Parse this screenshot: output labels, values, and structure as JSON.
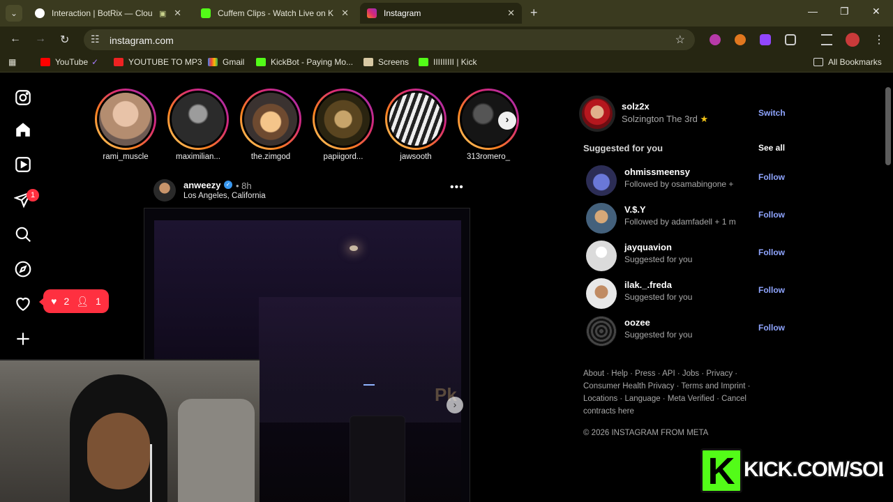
{
  "browser": {
    "tabs": [
      {
        "title": "Interaction | BotRix — Clou",
        "active": false
      },
      {
        "title": "Cuffem Clips - Watch Live on Ki",
        "active": false
      },
      {
        "title": "Instagram",
        "active": true
      }
    ],
    "url": "instagram.com",
    "bookmarks": [
      "YouTube",
      "YOUTUBE TO MP3",
      "Gmail",
      "KickBot - Paying Mo...",
      "Screens",
      "IIIIIIIII | Kick"
    ],
    "all_bookmarks": "All Bookmarks"
  },
  "sidebar": {
    "messages_badge": "1",
    "notif_likes": "2",
    "notif_follows": "1"
  },
  "stories": [
    {
      "name": "rami_muscle"
    },
    {
      "name": "maximilian..."
    },
    {
      "name": "the.zimgod"
    },
    {
      "name": "papiigord..."
    },
    {
      "name": "jawsooth"
    },
    {
      "name": "313romero_"
    }
  ],
  "post": {
    "username": "anweezy",
    "time": "8h",
    "location": "Los Angeles, California",
    "watermark": "Pk"
  },
  "profile": {
    "username": "solz2x",
    "full_name": "Solzington The 3rd",
    "switch_label": "Switch"
  },
  "suggestions": {
    "title": "Suggested for you",
    "see_all": "See all",
    "follow_label": "Follow",
    "items": [
      {
        "username": "ohmissmeensy",
        "subtitle": "Followed by osamabingone +"
      },
      {
        "username": "V.$.Y",
        "subtitle": "Followed by adamfadell + 1 m"
      },
      {
        "username": "jayquavion",
        "subtitle": "Suggested for you"
      },
      {
        "username": "ilak._.freda",
        "subtitle": "Suggested for you"
      },
      {
        "username": "oozee",
        "subtitle": "Suggested for you"
      }
    ]
  },
  "footer": {
    "links": "About · Help · Press · API · Jobs · Privacy · Consumer Health Privacy · Terms and Imprint · Locations · Language · Meta Verified · Cancel contracts here",
    "copyright": "© 2026 INSTAGRAM FROM META"
  },
  "overlay": {
    "kick_text": "KICK.COM/SOLZ"
  }
}
